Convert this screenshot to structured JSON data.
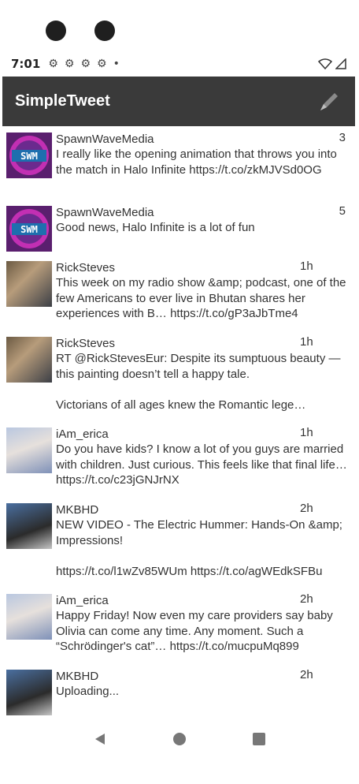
{
  "status_bar": {
    "time": "7:01",
    "icons": [
      "settings-icon",
      "settings-icon",
      "settings-icon",
      "settings-icon"
    ],
    "right_icons": [
      "wifi-icon",
      "signal-icon"
    ]
  },
  "app_bar": {
    "title": "SimpleTweet",
    "compose_icon": "compose-icon"
  },
  "tweets": [
    {
      "user": "SpawnWaveMedia",
      "time": "3",
      "text": "I really like the opening animation that throws you into the match in Halo Infinite https://t.co/zkMJVSd0OG",
      "avatar_text": "SWM"
    },
    {
      "user": "SpawnWaveMedia",
      "time": "5",
      "text": "Good news, Halo Infinite is a lot of fun",
      "avatar_text": "SWM"
    },
    {
      "user": "RickSteves",
      "time": "1h",
      "text": "This week on my radio show &amp; podcast, one of the few Americans to ever live in Bhutan shares her experiences with B… https://t.co/gP3aJbTme4"
    },
    {
      "user": "RickSteves",
      "time": "1h",
      "text": "RT @RickStevesEur: Despite its sumptuous beauty — this painting doesn’t tell a happy tale.\n\nVictorians of all ages knew the Romantic lege…"
    },
    {
      "user": "iAm_erica",
      "time": "1h",
      "text": "Do you have kids? I know a lot of you guys are married with children. Just curious. This feels like that final life… https://t.co/c23jGNJrNX"
    },
    {
      "user": "MKBHD",
      "time": "2h",
      "text": "NEW VIDEO - The Electric Hummer: Hands-On &amp; Impressions!\n\nhttps://t.co/l1wZv85WUm https://t.co/agWEdkSFBu"
    },
    {
      "user": "iAm_erica",
      "time": "2h",
      "text": "Happy Friday! Now even my care providers say baby Olivia can come any time. Any moment. Such a “Schrödinger's cat”… https://t.co/mucpuMq899"
    },
    {
      "user": "MKBHD",
      "time": "2h",
      "text": "Uploading..."
    }
  ],
  "nav_bar": {
    "back_icon": "back-icon",
    "home_icon": "home-icon",
    "recents_icon": "recents-icon"
  }
}
